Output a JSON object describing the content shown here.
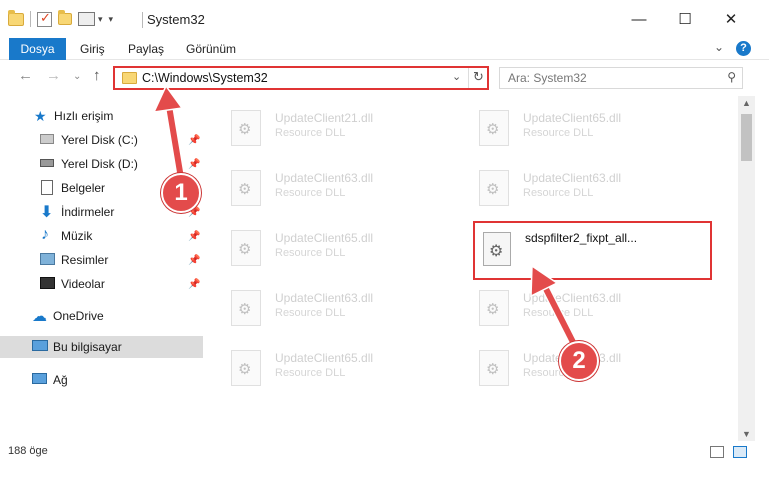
{
  "window": {
    "title": "System32"
  },
  "titlebar": {
    "minimize": "—",
    "maximize": "☐",
    "close": "✕"
  },
  "ribbon": {
    "tabs": [
      "Dosya",
      "Giriş",
      "Paylaş",
      "Görünüm"
    ],
    "help": "?"
  },
  "nav": {
    "address": "C:\\Windows\\System32",
    "search_placeholder": "Ara: System32"
  },
  "sidebar": {
    "quick_access": "Hızlı erişim",
    "items": [
      {
        "label": "Yerel Disk (C:)",
        "pinned": true
      },
      {
        "label": "Yerel Disk (D:)",
        "pinned": true
      },
      {
        "label": "Belgeler",
        "pinned": true
      },
      {
        "label": "İndirmeler",
        "pinned": true
      },
      {
        "label": "Müzik",
        "pinned": true
      },
      {
        "label": "Resimler",
        "pinned": true
      },
      {
        "label": "Videolar",
        "pinned": true
      }
    ],
    "onedrive": "OneDrive",
    "this_pc": "Bu bilgisayar",
    "network": "Ağ"
  },
  "files": {
    "left": [
      {
        "name": "UpdateClient21.dll",
        "type": "Resource DLL"
      },
      {
        "name": "UpdateClient63.dll",
        "type": "Resource DLL"
      },
      {
        "name": "UpdateClient65.dll",
        "type": "Resource DLL"
      },
      {
        "name": "UpdateClient63.dll",
        "type": "Resource DLL"
      },
      {
        "name": "UpdateClient65.dll",
        "type": "Resource DLL"
      }
    ],
    "right": [
      {
        "name": "UpdateClient65.dll",
        "type": "Resource DLL"
      },
      {
        "name": "UpdateClient63.dll",
        "type": "Resource DLL"
      },
      {
        "name": "UpdateClient63.dll",
        "type": "Resource DLL"
      },
      {
        "name": "UpdateClient63.dll",
        "type": "Resource DLL"
      }
    ],
    "highlighted": {
      "name": "sdspfilter2_fixpt_all..."
    }
  },
  "status": {
    "count": "188 öge"
  },
  "annotations": {
    "step1": "1",
    "step2": "2"
  },
  "colors": {
    "accent": "#1979ca",
    "highlight": "#e03434",
    "badge": "#e34b4b"
  }
}
